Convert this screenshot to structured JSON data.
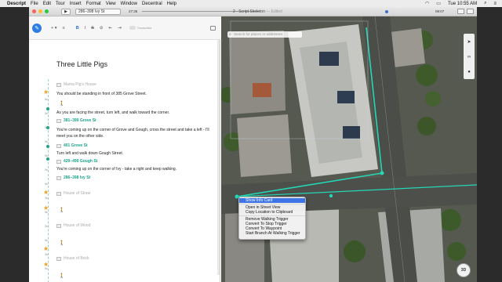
{
  "menubar": {
    "app": "Descript",
    "menus": [
      "File",
      "Edit",
      "Tour",
      "Insert",
      "Format",
      "View",
      "Window",
      "Decentral",
      "Help"
    ],
    "clock": "Tue 10:55 AM"
  },
  "window": {
    "title": "2 - Script Skeleton",
    "edited": "— Edited",
    "scene": "286–398 Ivy St",
    "time_start": "27:36",
    "time_end": "08:07"
  },
  "editor": {
    "toolbar": {
      "bold": "B",
      "italic": "I",
      "strike": "S",
      "transcribe_label": "Transcribe"
    },
    "heading": "Three Little Pigs",
    "lines": [
      {
        "kind": "wp",
        "text": "Mama Pig's House",
        "style": "muted"
      },
      {
        "kind": "text",
        "text": "You should be standing in front of 385 Grove Street."
      },
      {
        "kind": "walk"
      },
      {
        "kind": "text",
        "text": "As you are facing the street, turn left, and walk toward the corner."
      },
      {
        "kind": "wp",
        "text": "381–399 Grove St",
        "style": "link"
      },
      {
        "kind": "text",
        "text": "You're coming up on the corner of Grove and Gough, cross the street and take a left - I'll"
      },
      {
        "kind": "text",
        "text": "meet you on the other side."
      },
      {
        "kind": "wp",
        "text": "401 Grove St",
        "style": "link"
      },
      {
        "kind": "text",
        "text": "Turn left and walk down Gough Street."
      },
      {
        "kind": "wp",
        "text": "429–499 Gough St",
        "style": "link"
      },
      {
        "kind": "text",
        "text": "You're coming up on the corner of Ivy - take a right and keep walking."
      },
      {
        "kind": "wp",
        "text": "286–398 Ivy St",
        "style": "link"
      },
      {
        "kind": "wp",
        "text": "House of Straw",
        "style": "muted"
      },
      {
        "kind": "walk"
      },
      {
        "kind": "wp",
        "text": "House of Wood",
        "style": "muted"
      },
      {
        "kind": "walk"
      },
      {
        "kind": "wp",
        "text": "House of Brick",
        "style": "muted"
      },
      {
        "kind": "walk"
      },
      {
        "kind": "wp",
        "text": "Symphony Center Balcony",
        "style": "muted"
      }
    ],
    "gutter": [
      "5s",
      "3s",
      "5s",
      "3s",
      "5s",
      "3s",
      "5s",
      "3s",
      "5s",
      "3s",
      "5s",
      "3s",
      "5s"
    ]
  },
  "map": {
    "search_placeholder": "Search for places or addresses",
    "controls": [
      "location-arrow-icon",
      "link-icon",
      "pin-icon"
    ],
    "compass": "3D"
  },
  "context_menu": {
    "items": [
      "Show Info Card",
      "---",
      "Open in Street View",
      "Copy Location to Clipboard",
      "---",
      "Remove Walking Trigger",
      "Convert To Stop Trigger",
      "Convert To Waypoint",
      "Start Branch At Walking Trigger"
    ],
    "highlighted": 0
  }
}
